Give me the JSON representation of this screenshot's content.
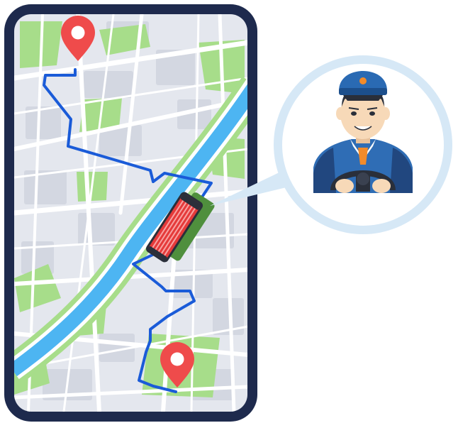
{
  "scene": {
    "name": "ride-tracking-illustration",
    "colors": {
      "phone_frame": "#1e2a4d",
      "map_bg": "#e4e7ee",
      "block": "#d3d7e1",
      "street": "#ffffff",
      "park": "#a7dd8a",
      "river": "#4db5f2",
      "route": "#1a5bd8",
      "pin": "#ef4b4b",
      "bus_body": "#e53a3a",
      "bus_stripe": "#f7a3a3",
      "bus_shadow": "#4f8f3d",
      "bubble_ring": "#d6e8f6",
      "driver_uniform": "#2f6db5",
      "driver_skin": "#f7d9b8",
      "driver_cap": "#2a6ab3",
      "cap_badge": "#f28b2a",
      "steering_wheel": "#2a2f3a"
    },
    "icons": {
      "start": "map-pin-icon",
      "end": "map-pin-icon",
      "vehicle": "bus-icon",
      "driver": "driver-avatar-icon"
    }
  }
}
